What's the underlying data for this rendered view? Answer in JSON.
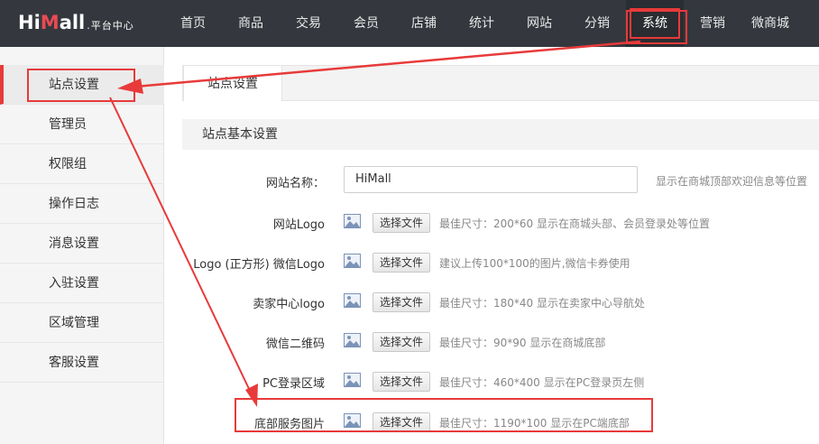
{
  "logo": {
    "main_a": "Hi",
    "main_m": "M",
    "main_b": "all",
    "sub": ".平台中心"
  },
  "nav": {
    "items": [
      "首页",
      "商品",
      "交易",
      "会员",
      "店铺",
      "统计",
      "网站",
      "分销",
      "系统",
      "营销",
      "微商城"
    ],
    "active": "系统"
  },
  "sidebar": {
    "items": [
      "站点设置",
      "管理员",
      "权限组",
      "操作日志",
      "消息设置",
      "入驻设置",
      "区域管理",
      "客服设置"
    ],
    "active": "站点设置"
  },
  "tab": {
    "label": "站点设置"
  },
  "section": {
    "title": "站点基本设置"
  },
  "form": {
    "site_name": {
      "label": "网站名称：",
      "value": "HiMall",
      "hint": "显示在商城顶部欢迎信息等位置"
    },
    "file_button_label": "选择文件",
    "rows": [
      {
        "label": "网站Logo",
        "hint": "最佳尺寸：200*60 显示在商城头部、会员登录处等位置"
      },
      {
        "label": "Logo (正方形) 微信Logo",
        "hint": "建议上传100*100的图片,微信卡券使用"
      },
      {
        "label": "卖家中心logo",
        "hint": "最佳尺寸：180*40 显示在卖家中心导航处"
      },
      {
        "label": "微信二维码",
        "hint": "最佳尺寸：90*90 显示在商城底部"
      },
      {
        "label": "PC登录区域",
        "hint": "最佳尺寸：460*400 显示在PC登录页左侧"
      },
      {
        "label": "底部服务图片",
        "hint": "最佳尺寸：1190*100 显示在PC端底部"
      }
    ]
  },
  "colors": {
    "topbar": "#34383e",
    "accent_red": "#e83a3a",
    "logo_m": "#e94a54",
    "sidebar_bg": "#f5f5f5"
  },
  "icons": {
    "image_upload": "image-icon"
  }
}
